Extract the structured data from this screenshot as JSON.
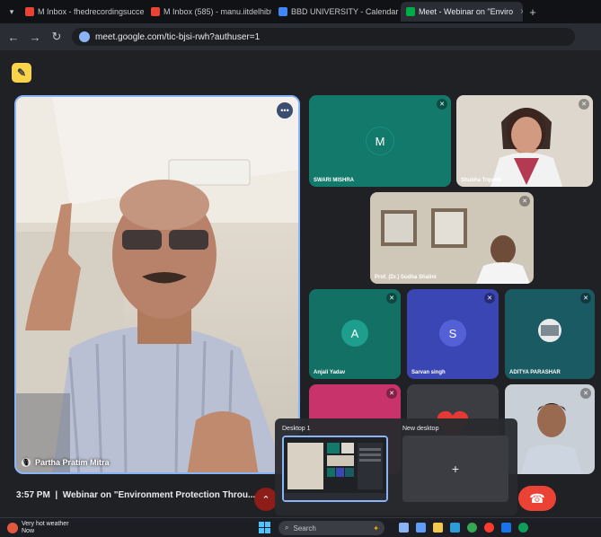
{
  "browser": {
    "tabs": [
      {
        "title": "M Inbox - fhedrecordingsuccessful - ",
        "favicon_color": "#ea4335"
      },
      {
        "title": "M Inbox (585) - manu.iitdelhibt",
        "favicon_color": "#ea4335"
      },
      {
        "title": "BBD UNIVERSITY - Calendar - ",
        "favicon_color": "#4285f4"
      },
      {
        "title": "Meet - Webinar on \"Enviro",
        "favicon_color": "#00ac47",
        "active": true
      }
    ],
    "url": "meet.google.com/tic-bjsi-rwh?authuser=1"
  },
  "meet": {
    "main_speaker": {
      "name": "Partha Pratim Mitra"
    },
    "tiles": [
      {
        "label": "SWARI MISHRA",
        "initial": "M",
        "bg": "#13796a",
        "avatar_color": "#13796a"
      },
      {
        "label": "Shubha Tripathi",
        "bg": "#d8d3cb",
        "video": true
      },
      {
        "label": "Prof. (Dr.) Sudha Shalini",
        "bg": "#cfc7b8",
        "video": true
      },
      {
        "label": "Anjali Yadav",
        "initial": "A",
        "bg": "#127065",
        "avatar_color": "#1e9e8d"
      },
      {
        "label": "Sarvan singh",
        "initial": "S",
        "bg": "#3b46b5",
        "avatar_color": "#5360d6"
      },
      {
        "label": "ADITYA PARASHAR",
        "bg": "#1a5a63",
        "video": true
      },
      {
        "label": "",
        "bg": "#c8336b"
      },
      {
        "label": "",
        "bg": "#3c3d42"
      },
      {
        "label": "",
        "bg": "#c9cfd6",
        "video": true
      }
    ],
    "meeting_time": "3:57 PM",
    "meeting_title": "Webinar on \"Environment Protection Throu..."
  },
  "taskview": {
    "desktop1": "Desktop 1",
    "desktop2": "New desktop",
    "add_symbol": "+"
  },
  "taskbar": {
    "weather_line1": "Very hot weather",
    "weather_line2": "Now",
    "search_placeholder": "Search"
  }
}
